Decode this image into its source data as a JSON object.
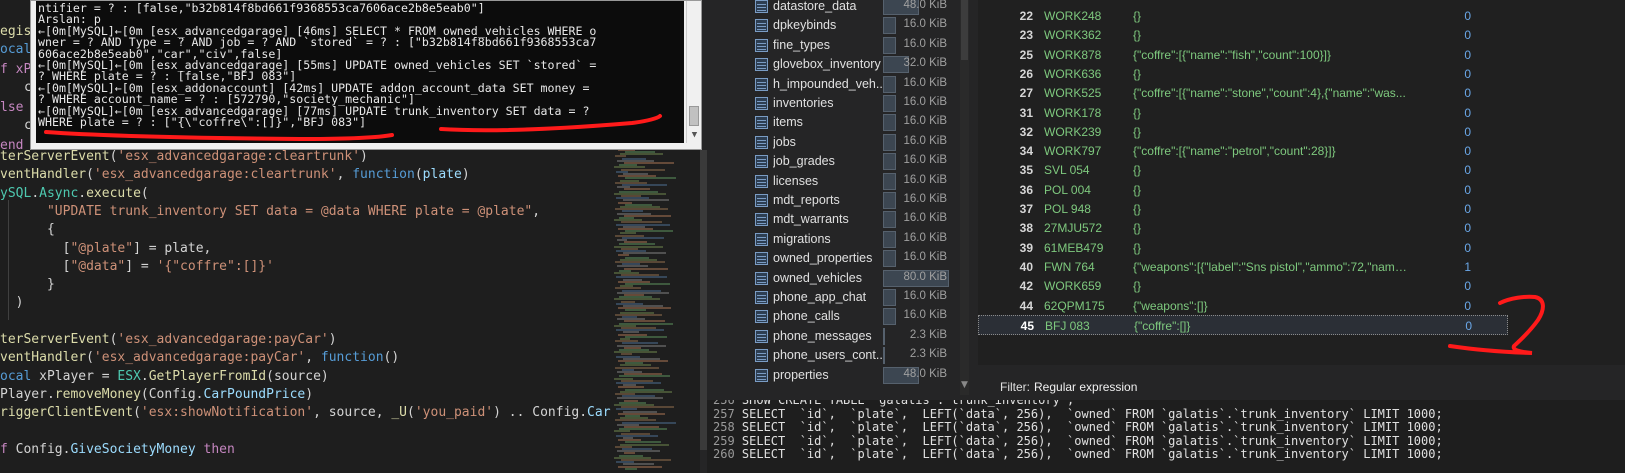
{
  "console": {
    "lines": [
      "ntifier = ? : [false,\"b32b814f8bd661f9368553ca7606ace2b8e5eab0\"]",
      "Arslan: p",
      "←[0m[MySQL]←[0m [esx_advancedgarage] [46ms] SELECT * FROM owned_vehicles WHERE o",
      "wner = ? AND Type = ? AND job = ? AND `stored` = ? : [\"b32b814f8bd661f9368553ca7",
      "606ace2b8e5eab0\",\"car\",\"civ\",false]",
      "←[0m[MySQL]←[0m [esx_advancedgarage] [55ms] UPDATE owned_vehicles SET `stored` =",
      "? WHERE plate = ? : [false,\"BFJ 083\"]",
      "←[0m[MySQL]←[0m [esx_addonaccount] [42ms] UPDATE addon_account_data SET money =",
      "? WHERE account_name = ? : [572790,\"society_mechanic\"]",
      "←[0m[MySQL]←[0m [esx_advancedgarage] [77ms] UPDATE trunk_inventory SET data = ?",
      "WHERE plate = ? : [\"{\\\"coffre\\\":[]}\",\"BFJ 083\"]"
    ],
    "scroll_arrow": "▼"
  },
  "editor": {
    "left_fragments": [
      "egis",
      "ocal",
      "f xP",
      "c",
      "lse",
      "c",
      "end"
    ],
    "lines": [
      {
        "segs": [
          [
            "fn",
            "terServerEvent"
          ],
          [
            "plain",
            "("
          ],
          [
            "str",
            "'esx_advancedgarage:cleartrunk'"
          ],
          [
            "plain",
            ")"
          ]
        ]
      },
      {
        "segs": [
          [
            "fn",
            "ventHandler"
          ],
          [
            "plain",
            "("
          ],
          [
            "str",
            "'esx_advancedgarage:cleartrunk'"
          ],
          [
            "plain",
            ", "
          ],
          [
            "kw",
            "function"
          ],
          [
            "plain",
            "("
          ],
          [
            "var",
            "plate"
          ],
          [
            "plain",
            ")"
          ]
        ]
      },
      {
        "segs": [
          [
            "cls",
            "ySQL"
          ],
          [
            "plain",
            "."
          ],
          [
            "cls",
            "Async"
          ],
          [
            "plain",
            "."
          ],
          [
            "fn",
            "execute"
          ],
          [
            "plain",
            "("
          ]
        ]
      },
      {
        "segs": [
          [
            "plain",
            "      "
          ],
          [
            "str",
            "\"UPDATE trunk_inventory SET data = @data WHERE plate = @plate\""
          ],
          [
            "plain",
            ","
          ]
        ]
      },
      {
        "segs": [
          [
            "plain",
            "      {"
          ]
        ]
      },
      {
        "segs": [
          [
            "plain",
            "        ["
          ],
          [
            "str",
            "\"@plate\""
          ],
          [
            "plain",
            "] = plate,"
          ]
        ]
      },
      {
        "segs": [
          [
            "plain",
            "        ["
          ],
          [
            "str",
            "\"@data\""
          ],
          [
            "plain",
            "] = "
          ],
          [
            "str",
            "'{\"coffre\":[]}'"
          ]
        ]
      },
      {
        "segs": [
          [
            "plain",
            "      }"
          ]
        ]
      },
      {
        "segs": [
          [
            "plain",
            "  )"
          ]
        ]
      },
      {
        "segs": [
          [
            "plain",
            ""
          ]
        ]
      },
      {
        "segs": [
          [
            "fn",
            "terServerEvent"
          ],
          [
            "plain",
            "("
          ],
          [
            "str",
            "'esx_advancedgarage:payCar'"
          ],
          [
            "plain",
            ")"
          ]
        ]
      },
      {
        "segs": [
          [
            "fn",
            "ventHandler"
          ],
          [
            "plain",
            "("
          ],
          [
            "str",
            "'esx_advancedgarage:payCar'"
          ],
          [
            "plain",
            ", "
          ],
          [
            "kw",
            "function"
          ],
          [
            "plain",
            "()"
          ]
        ]
      },
      {
        "segs": [
          [
            "kw",
            "ocal"
          ],
          [
            "plain",
            " xPlayer = "
          ],
          [
            "cls",
            "ESX"
          ],
          [
            "plain",
            "."
          ],
          [
            "fn",
            "GetPlayerFromId"
          ],
          [
            "plain",
            "(source)"
          ]
        ]
      },
      {
        "segs": [
          [
            "plain",
            "Player."
          ],
          [
            "fn",
            "removeMoney"
          ],
          [
            "plain",
            "(Config."
          ],
          [
            "var",
            "CarPoundPrice"
          ],
          [
            "plain",
            ")"
          ]
        ]
      },
      {
        "segs": [
          [
            "fn",
            "riggerClientEvent"
          ],
          [
            "plain",
            "("
          ],
          [
            "str",
            "'esx:showNotification'"
          ],
          [
            "plain",
            ", source, "
          ],
          [
            "fn",
            "_U"
          ],
          [
            "plain",
            "("
          ],
          [
            "str",
            "'you_paid'"
          ],
          [
            "plain",
            ") .. Config."
          ],
          [
            "var",
            "Car"
          ]
        ]
      },
      {
        "segs": [
          [
            "plain",
            ""
          ]
        ]
      },
      {
        "segs": [
          [
            "kw2",
            "f"
          ],
          [
            "plain",
            " Config."
          ],
          [
            "var",
            "GiveSocietyMoney"
          ],
          [
            "plain",
            " "
          ],
          [
            "kw2",
            "then"
          ]
        ]
      }
    ]
  },
  "tree": {
    "items": [
      {
        "name": "datastore_data",
        "size": "48.0 KiB",
        "fill": 0.55
      },
      {
        "name": "dpkeybinds",
        "size": "16.0 KiB",
        "fill": 0.2
      },
      {
        "name": "fine_types",
        "size": "16.0 KiB",
        "fill": 0.2
      },
      {
        "name": "glovebox_inventory",
        "size": "32.0 KiB",
        "fill": 0.4
      },
      {
        "name": "h_impounded_veh...",
        "size": "16.0 KiB",
        "fill": 0.2
      },
      {
        "name": "inventories",
        "size": "16.0 KiB",
        "fill": 0.2
      },
      {
        "name": "items",
        "size": "16.0 KiB",
        "fill": 0.2
      },
      {
        "name": "jobs",
        "size": "16.0 KiB",
        "fill": 0.2
      },
      {
        "name": "job_grades",
        "size": "16.0 KiB",
        "fill": 0.2
      },
      {
        "name": "licenses",
        "size": "16.0 KiB",
        "fill": 0.2
      },
      {
        "name": "mdt_reports",
        "size": "16.0 KiB",
        "fill": 0.2
      },
      {
        "name": "mdt_warrants",
        "size": "16.0 KiB",
        "fill": 0.2
      },
      {
        "name": "migrations",
        "size": "16.0 KiB",
        "fill": 0.2
      },
      {
        "name": "owned_properties",
        "size": "16.0 KiB",
        "fill": 0.2
      },
      {
        "name": "owned_vehicles",
        "size": "80.0 KiB",
        "fill": 1.0
      },
      {
        "name": "phone_app_chat",
        "size": "16.0 KiB",
        "fill": 0.2
      },
      {
        "name": "phone_calls",
        "size": "16.0 KiB",
        "fill": 0.2
      },
      {
        "name": "phone_messages",
        "size": "2.3 KiB",
        "fill": 0.03
      },
      {
        "name": "phone_users_cont...",
        "size": "2.3 KiB",
        "fill": 0.03
      },
      {
        "name": "properties",
        "size": "48.0 KiB",
        "fill": 0.55
      }
    ],
    "scroll_down": "▼"
  },
  "grid": {
    "rows": [
      {
        "id": "22",
        "plate": "WORK248",
        "data": "{}",
        "owned": "0"
      },
      {
        "id": "23",
        "plate": "WORK362",
        "data": "{}",
        "owned": "0"
      },
      {
        "id": "25",
        "plate": "WORK878",
        "data": "{\"coffre\":[{\"name\":\"fish\",\"count\":100}]}",
        "owned": "0"
      },
      {
        "id": "26",
        "plate": "WORK636",
        "data": "{}",
        "owned": "0"
      },
      {
        "id": "27",
        "plate": "WORK525",
        "data": "{\"coffre\":[{\"name\":\"stone\",\"count\":4},{\"name\":\"was...",
        "owned": "0"
      },
      {
        "id": "31",
        "plate": "WORK178",
        "data": "{}",
        "owned": "0"
      },
      {
        "id": "32",
        "plate": "WORK239",
        "data": "{}",
        "owned": "0"
      },
      {
        "id": "34",
        "plate": "WORK797",
        "data": "{\"coffre\":[{\"name\":\"petrol\",\"count\":28}]}",
        "owned": "0"
      },
      {
        "id": "35",
        "plate": "SVL 054",
        "data": "{}",
        "owned": "0"
      },
      {
        "id": "36",
        "plate": "POL 004",
        "data": "{}",
        "owned": "0"
      },
      {
        "id": "37",
        "plate": "POL 948",
        "data": "{}",
        "owned": "0"
      },
      {
        "id": "38",
        "plate": "27MJU572",
        "data": "{}",
        "owned": "0"
      },
      {
        "id": "39",
        "plate": "61MEB479",
        "data": "{}",
        "owned": "0"
      },
      {
        "id": "40",
        "plate": "FWN 764",
        "data": "{\"weapons\":[{\"label\":\"Sns pistol\",\"ammo\":72,\"name\"...",
        "owned": "1"
      },
      {
        "id": "42",
        "plate": "WORK659",
        "data": "{}",
        "owned": "0"
      },
      {
        "id": "44",
        "plate": "62QPM175",
        "data": "{\"weapons\":[]}",
        "owned": "0"
      },
      {
        "id": "45",
        "plate": "BFJ 083",
        "data": "{\"coffre\":[]}",
        "owned": "0",
        "selected": true
      }
    ]
  },
  "filter": {
    "label": "Filter:",
    "value": "Regular expression"
  },
  "sql_log": [
    {
      "ln": "256",
      "text": "SHOW CREATE TABLE `galatis`.`trunk_inventory`;"
    },
    {
      "ln": "257",
      "text": "SELECT  `id`,  `plate`,  LEFT(`data`, 256),  `owned` FROM `galatis`.`trunk_inventory` LIMIT 1000;"
    },
    {
      "ln": "258",
      "text": "SELECT  `id`,  `plate`,  LEFT(`data`, 256),  `owned` FROM `galatis`.`trunk_inventory` LIMIT 1000;"
    },
    {
      "ln": "259",
      "text": "SELECT  `id`,  `plate`,  LEFT(`data`, 256),  `owned` FROM `galatis`.`trunk_inventory` LIMIT 1000;"
    },
    {
      "ln": "260",
      "text": "SELECT  `id`,  `plate`,  LEFT(`data`, 256),  `owned` FROM `galatis`.`trunk_inventory` LIMIT 1000;"
    }
  ],
  "colors": {
    "annotation_red": "#ff1a1a",
    "plate_green": "#7ec97e",
    "owned_blue": "#6aa7e8"
  }
}
